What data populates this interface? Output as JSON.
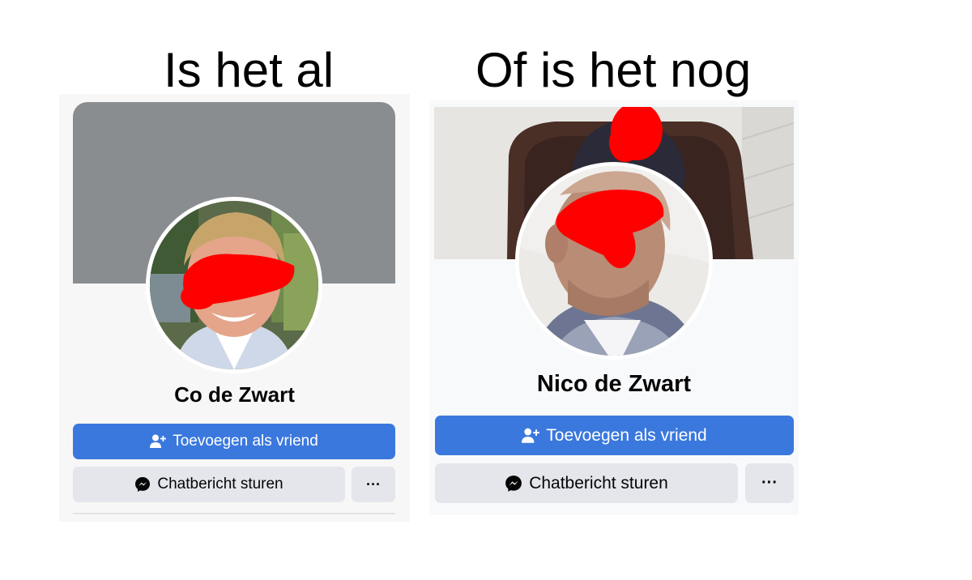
{
  "headings": {
    "left": "Is het al",
    "right": "Of is het nog"
  },
  "profiles": [
    {
      "name": "Co de Zwart",
      "add_friend_label": "Toevoegen als vriend",
      "message_label": "Chatbericht sturen",
      "more_label": "···",
      "cover_color": "#8a8d90"
    },
    {
      "name": "Nico de Zwart",
      "add_friend_label": "Toevoegen als vriend",
      "message_label": "Chatbericht sturen",
      "more_label": "···"
    }
  ],
  "colors": {
    "primary_button": "#3a78dd",
    "secondary_button": "#e4e6eb",
    "redaction": "#ff0000"
  },
  "icons": {
    "add_friend": "person-plus-icon",
    "message": "messenger-icon",
    "more": "more-dots-icon"
  }
}
